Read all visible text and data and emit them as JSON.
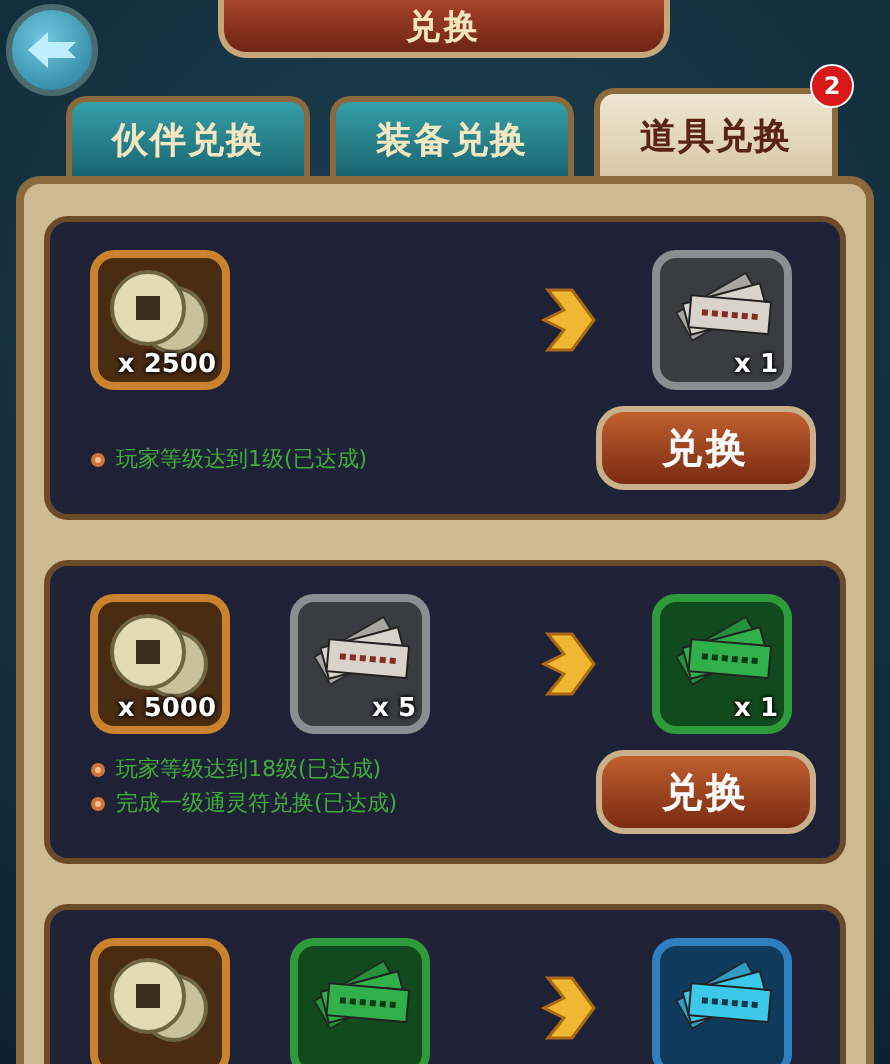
{
  "title": "兑换",
  "tabs": [
    {
      "label": "伙伴兑换",
      "selected": false
    },
    {
      "label": "装备兑换",
      "selected": false
    },
    {
      "label": "道具兑换",
      "selected": true,
      "badge": "2"
    }
  ],
  "exchanges": [
    {
      "inputs": [
        {
          "kind": "coin",
          "quantity": "x 2500"
        }
      ],
      "outputs": [
        {
          "kind": "gray-talisman",
          "quantity": "x 1"
        }
      ],
      "conditions": [
        "玩家等级达到1级(已达成)"
      ],
      "button": "兑换"
    },
    {
      "inputs": [
        {
          "kind": "coin",
          "quantity": "x 5000"
        },
        {
          "kind": "gray-talisman",
          "quantity": "x 5"
        }
      ],
      "outputs": [
        {
          "kind": "green-talisman",
          "quantity": "x 1"
        }
      ],
      "conditions": [
        "玩家等级达到18级(已达成)",
        "完成一级通灵符兑换(已达成)"
      ],
      "button": "兑换"
    },
    {
      "inputs": [
        {
          "kind": "coin"
        },
        {
          "kind": "green-talisman"
        }
      ],
      "outputs": [
        {
          "kind": "blue-talisman"
        }
      ]
    }
  ]
}
